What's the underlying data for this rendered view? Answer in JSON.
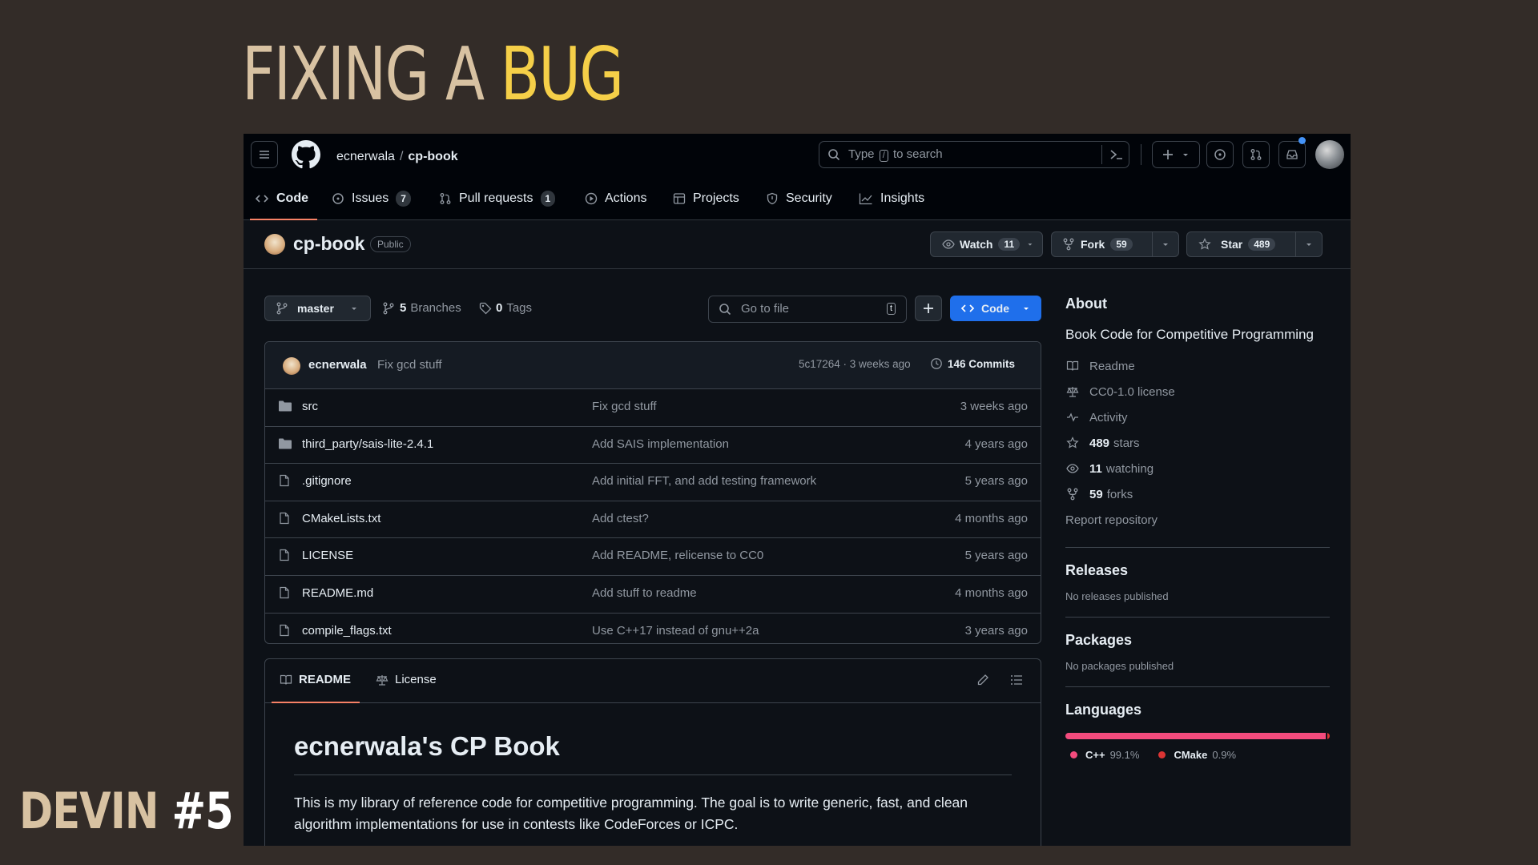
{
  "slide": {
    "title_main": "FIXING A ",
    "title_highlight": "BUG",
    "footer_label": "DEVIN ",
    "footer_number": "#5"
  },
  "header": {
    "owner": "ecnerwala",
    "separator": "/",
    "repo": "cp-book",
    "search_prefix": "Type",
    "search_key": "/",
    "search_suffix": "to search",
    "icons": [
      "menu-icon",
      "github-logo-icon",
      "terminal-icon",
      "plus-icon",
      "issues-icon",
      "pull-requests-icon",
      "inbox-icon",
      "avatar"
    ]
  },
  "tabs": [
    {
      "label": "Code",
      "icon": "code-icon",
      "active": true
    },
    {
      "label": "Issues",
      "icon": "issue-icon",
      "count": "7"
    },
    {
      "label": "Pull requests",
      "icon": "pull-request-icon",
      "count": "1"
    },
    {
      "label": "Actions",
      "icon": "play-icon"
    },
    {
      "label": "Projects",
      "icon": "table-icon"
    },
    {
      "label": "Security",
      "icon": "shield-icon"
    },
    {
      "label": "Insights",
      "icon": "graph-icon"
    }
  ],
  "repo": {
    "name": "cp-book",
    "visibility": "Public",
    "watch_label": "Watch",
    "watch_count": "11",
    "fork_label": "Fork",
    "fork_count": "59",
    "star_label": "Star",
    "star_count": "489"
  },
  "branchbar": {
    "branch": "master",
    "branches_count": "5",
    "branches_label": "Branches",
    "tags_count": "0",
    "tags_label": "Tags",
    "goto_placeholder": "Go to file",
    "goto_key": "t",
    "code_button": "Code"
  },
  "commit": {
    "author": "ecnerwala",
    "message": "Fix gcd stuff",
    "hash_time": "5c17264 · 3 weeks ago",
    "commits_label": "146 Commits"
  },
  "files": [
    {
      "name": "src",
      "type": "folder",
      "message": "Fix gcd stuff",
      "date": "3 weeks ago"
    },
    {
      "name": "third_party/sais-lite-2.4.1",
      "type": "folder",
      "message": "Add SAIS implementation",
      "date": "4 years ago"
    },
    {
      "name": ".gitignore",
      "type": "file",
      "message": "Add initial FFT, and add testing framework",
      "date": "5 years ago"
    },
    {
      "name": "CMakeLists.txt",
      "type": "file",
      "message": "Add ctest?",
      "date": "4 months ago"
    },
    {
      "name": "LICENSE",
      "type": "file",
      "message": "Add README, relicense to CC0",
      "date": "5 years ago"
    },
    {
      "name": "README.md",
      "type": "file",
      "message": "Add stuff to readme",
      "date": "4 months ago"
    },
    {
      "name": "compile_flags.txt",
      "type": "file",
      "message": "Use C++17 instead of gnu++2a",
      "date": "3 years ago"
    }
  ],
  "readme": {
    "tab_readme": "README",
    "tab_license": "License",
    "heading": "ecnerwala's CP Book",
    "body": "This is my library of reference code for competitive programming. The goal is to write generic, fast, and clean algorithm implementations for use in contests like CodeForces or ICPC."
  },
  "about": {
    "title": "About",
    "description": "Book Code for Competitive Programming",
    "readme": "Readme",
    "license": "CC0-1.0 license",
    "activity": "Activity",
    "stars_count": "489",
    "stars_label": "stars",
    "watching_count": "11",
    "watching_label": "watching",
    "forks_count": "59",
    "forks_label": "forks",
    "report": "Report repository"
  },
  "releases": {
    "title": "Releases",
    "text": "No releases published"
  },
  "packages": {
    "title": "Packages",
    "text": "No packages published"
  },
  "languages": {
    "title": "Languages",
    "items": [
      {
        "name": "C++",
        "percent": "99.1%",
        "value": 99.1,
        "color": "#f34b7d"
      },
      {
        "name": "CMake",
        "percent": "0.9%",
        "value": 0.9,
        "color": "#da3434"
      }
    ]
  },
  "colors": {
    "slide_bg": "#332c28",
    "slide_title": "#d8c2a2",
    "slide_highlight": "#f5cf48",
    "github_bg": "#0d1117",
    "accent_tab": "#f78166",
    "code_button": "#1f6feb"
  }
}
